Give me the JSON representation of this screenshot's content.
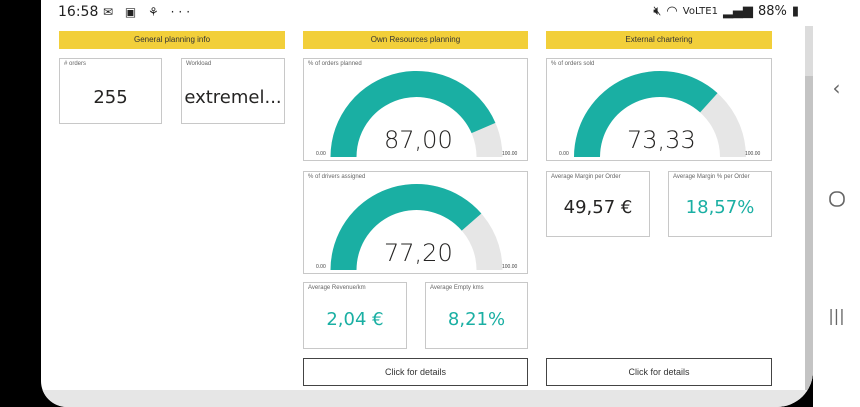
{
  "status_bar": {
    "time": "16:58",
    "left_icons": "✉ ▣ ⚘ ···",
    "signal": "VoLTE1",
    "battery": "88%"
  },
  "colors": {
    "header_yellow": "#f2cf3a",
    "teal": "#1aafa3",
    "gauge_track": "#e6e6e6"
  },
  "sections": {
    "general": "General planning info",
    "own": "Own Resources planning",
    "external": "External chartering"
  },
  "cards": {
    "orders": {
      "label": "# orders",
      "value": "255"
    },
    "workload": {
      "label": "Workload",
      "value": "extremel..."
    },
    "avg_revenue": {
      "label": "Average Revenue/km",
      "value": "2,04 €"
    },
    "avg_empty": {
      "label": "Average Empty kms",
      "value": "8,21%"
    },
    "avg_margin": {
      "label": "Average Margin per Order",
      "value": "49,57 €"
    },
    "avg_margin_pct": {
      "label": "Average Margin % per Order",
      "value": "18,57%"
    }
  },
  "gauges": {
    "orders_planned": {
      "label": "% of orders planned",
      "value_text": "87,00",
      "value": 87,
      "min_text": "0.00",
      "max_text": "100.00",
      "min": 0,
      "max": 100
    },
    "drivers_assigned": {
      "label": "% of drivers assigned",
      "value_text": "77,20",
      "value": 77.2,
      "min_text": "0.00",
      "max_text": "100.00",
      "min": 0,
      "max": 100
    },
    "orders_sold": {
      "label": "% of orders sold",
      "value_text": "73,33",
      "value": 73.33,
      "min_text": "0.00",
      "max_text": "100.00",
      "min": 0,
      "max": 100
    }
  },
  "buttons": {
    "details_own": "Click for details",
    "details_external": "Click for details"
  },
  "nav": {
    "back_icon": "back-chevron-icon",
    "home_icon": "home-circle-icon",
    "recents_icon": "recents-bars-icon"
  }
}
